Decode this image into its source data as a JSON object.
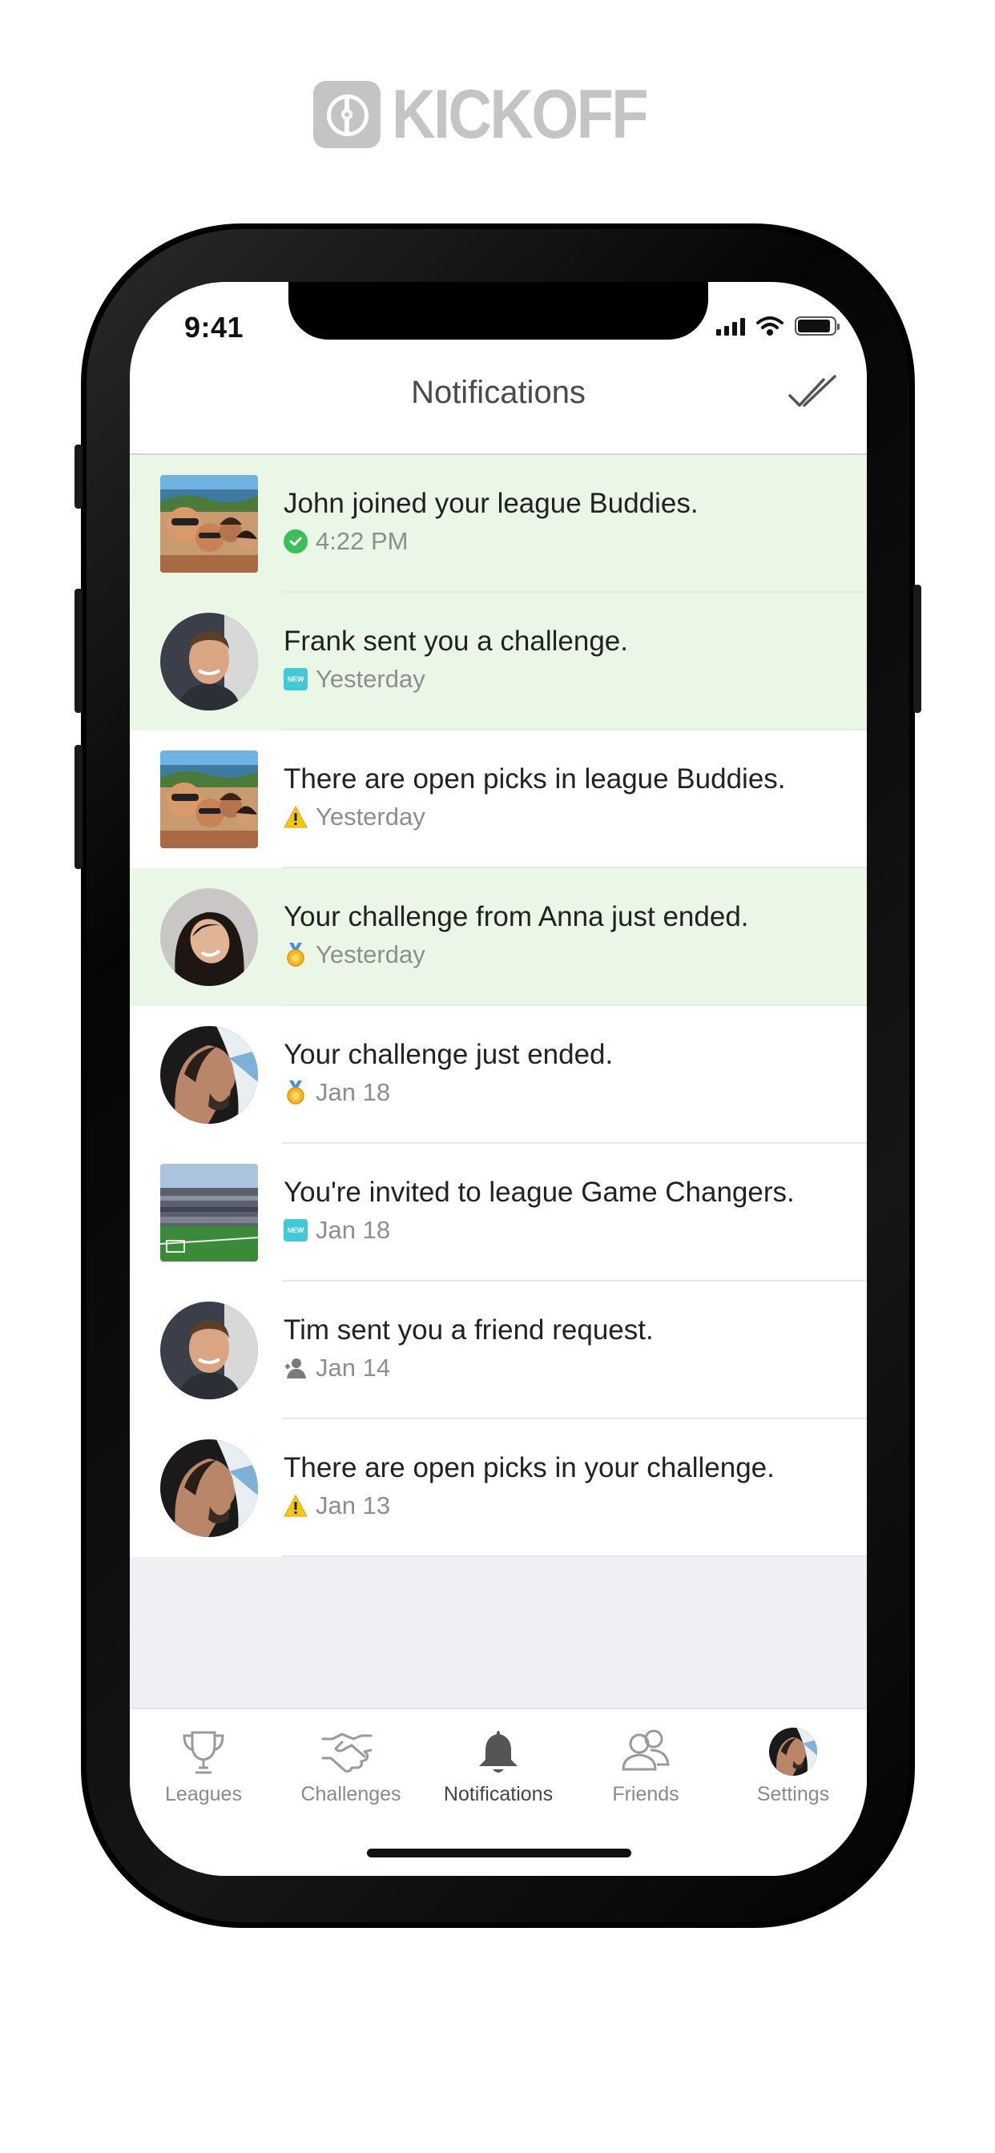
{
  "brand": {
    "name": "KICKOFF"
  },
  "status_bar": {
    "time": "9:41"
  },
  "nav": {
    "title": "Notifications",
    "mark_all_read_icon": "double-check-icon"
  },
  "notifications": [
    {
      "message": "John joined your league Buddies.",
      "meta_icon": "check-circle-icon",
      "time": "4:22 PM",
      "unread": true,
      "avatar": "group-selfie",
      "avatar_shape": "square"
    },
    {
      "message": "Frank sent you a challenge.",
      "meta_icon": "new-badge-icon",
      "badge_text": "NEW",
      "time": "Yesterday",
      "unread": true,
      "avatar": "man-portrait",
      "avatar_shape": "round"
    },
    {
      "message": "There are open picks in league Buddies.",
      "meta_icon": "warning-icon",
      "time": "Yesterday",
      "unread": false,
      "avatar": "group-selfie",
      "avatar_shape": "square"
    },
    {
      "message": "Your challenge from Anna just ended.",
      "meta_icon": "medal-icon",
      "time": "Yesterday",
      "unread": true,
      "avatar": "woman-portrait",
      "avatar_shape": "round"
    },
    {
      "message": "Your challenge just ended.",
      "meta_icon": "medal-icon",
      "time": "Jan 18",
      "unread": false,
      "avatar": "man-profile",
      "avatar_shape": "round"
    },
    {
      "message": "You're invited to league Game Changers.",
      "meta_icon": "new-badge-icon",
      "badge_text": "NEW",
      "time": "Jan 18",
      "unread": false,
      "avatar": "stadium",
      "avatar_shape": "square"
    },
    {
      "message": "Tim sent you a friend request.",
      "meta_icon": "friend-icon",
      "time": "Jan 14",
      "unread": false,
      "avatar": "man-portrait",
      "avatar_shape": "round"
    },
    {
      "message": "There are open picks in your challenge.",
      "meta_icon": "warning-icon",
      "time": "Jan 13",
      "unread": false,
      "avatar": "man-profile",
      "avatar_shape": "round"
    }
  ],
  "tabs": [
    {
      "label": "Leagues",
      "icon": "trophy-icon",
      "active": false
    },
    {
      "label": "Challenges",
      "icon": "handshake-icon",
      "active": false
    },
    {
      "label": "Notifications",
      "icon": "bell-icon",
      "active": true
    },
    {
      "label": "Friends",
      "icon": "friends-icon",
      "active": false
    },
    {
      "label": "Settings",
      "icon": "profile-avatar",
      "active": false
    }
  ],
  "colors": {
    "unread_bg": "#eaf6e6",
    "brand_grey": "#c4c4c4",
    "check_green": "#3cbf5a",
    "new_teal": "#41c9d8",
    "warning_yellow": "#f5c518"
  }
}
